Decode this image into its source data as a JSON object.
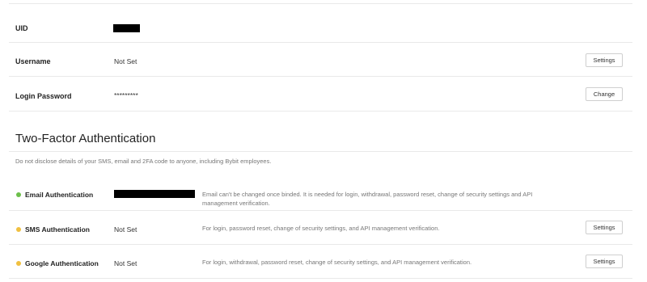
{
  "account": {
    "uid": {
      "label": "UID"
    },
    "username": {
      "label": "Username",
      "value": "Not Set",
      "button": "Settings"
    },
    "password": {
      "label": "Login Password",
      "value": "*********",
      "button": "Change"
    }
  },
  "two_factor": {
    "title": "Two-Factor Authentication",
    "note": "Do not disclose details of your SMS, email and 2FA code to anyone, including Bybit employees.",
    "items": [
      {
        "label": "Email Authentication",
        "status_color": "#6cbf4a",
        "description": "Email can't be changed once binded. It is needed for login, withdrawal, password reset, change of security settings and API management verification."
      },
      {
        "label": "SMS Authentication",
        "value": "Not Set",
        "status_color": "#f0c040",
        "description": "For login, password reset, change of security settings, and API management verification.",
        "button": "Settings"
      },
      {
        "label": "Google Authentication",
        "value": "Not Set",
        "status_color": "#f0c040",
        "description": "For login, withdrawal, password reset, change of security settings, and API management verification.",
        "button": "Settings"
      }
    ]
  },
  "colors": {
    "enabled": "#6cbf4a",
    "not_set": "#f0c040",
    "redaction": "#000000"
  }
}
